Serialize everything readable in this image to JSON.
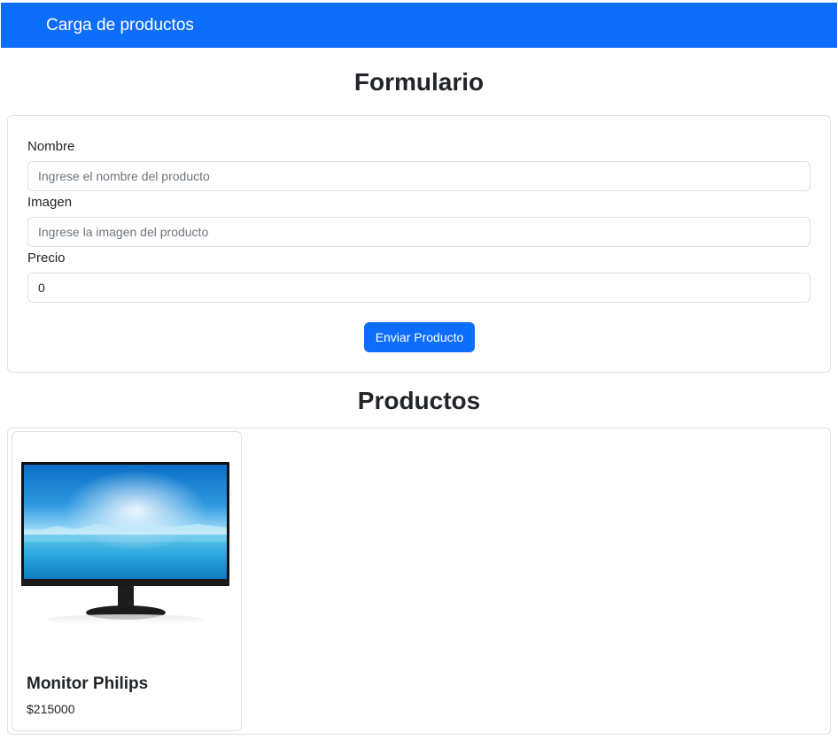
{
  "navbar": {
    "brand": "Carga de productos"
  },
  "form": {
    "title": "Formulario",
    "fields": {
      "nombre": {
        "label": "Nombre",
        "placeholder": "Ingrese el nombre del producto",
        "value": ""
      },
      "imagen": {
        "label": "Imagen",
        "placeholder": "Ingrese la imagen del producto",
        "value": ""
      },
      "precio": {
        "label": "Precio",
        "placeholder": "",
        "value": "0"
      }
    },
    "submit_label": "Enviar Producto"
  },
  "products": {
    "title": "Productos",
    "items": [
      {
        "name": "Monitor Philips",
        "price": "$215000",
        "image": "monitor-image"
      }
    ]
  },
  "colors": {
    "primary": "#0d6efd",
    "border": "#dee2e6",
    "text": "#212529"
  }
}
